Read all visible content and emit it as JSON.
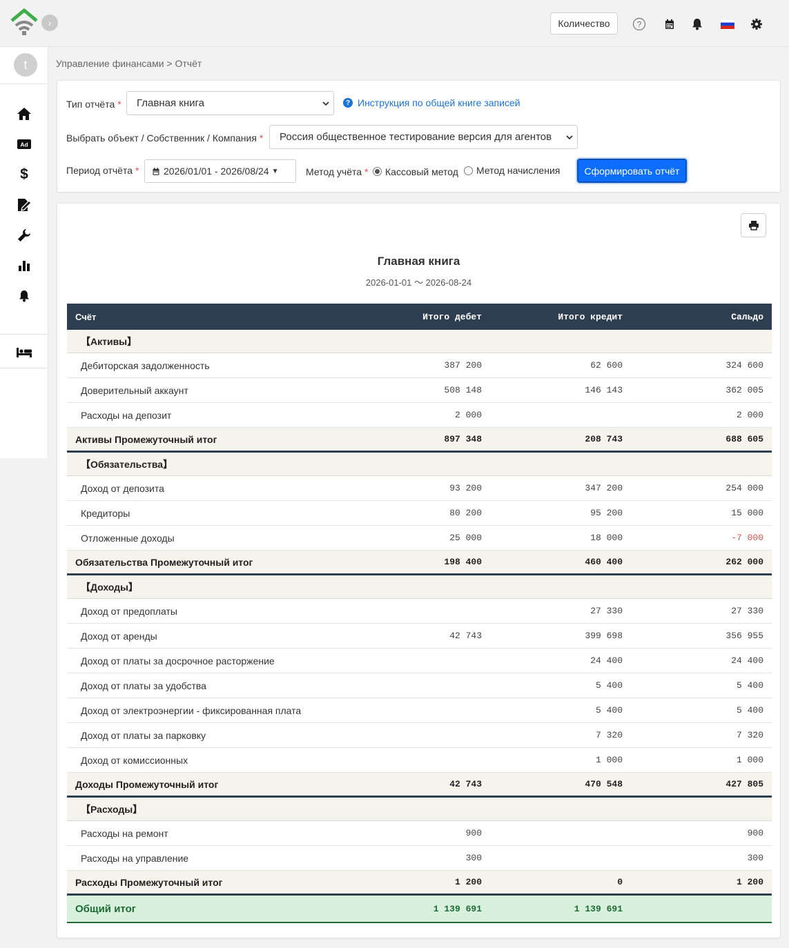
{
  "header": {
    "quantity_button": "Количество",
    "icons": [
      "help-icon",
      "calendar-icon",
      "bell-icon",
      "russia-flag-icon",
      "gear-icon"
    ]
  },
  "sidebar": {
    "avatar_initial": "t",
    "items": [
      "home-icon",
      "ad-icon",
      "dollar-icon",
      "contract-icon",
      "wrench-icon",
      "bar-chart-icon",
      "bell-icon",
      "bed-icon"
    ]
  },
  "breadcrumb": "Управление финансами > Отчёт",
  "filters": {
    "report_type_label": "Тип отчёта",
    "report_type_value": "Главная книга",
    "help_link": "Инструкция по общей книге записей",
    "object_label": "Выбрать объект / Собственник / Компания",
    "object_value": "Россия общественное тестирование версия для агентов",
    "period_label": "Период отчёта",
    "period_value": "2026/01/01 - 2026/08/24",
    "method_label": "Метод учёта",
    "method_cash": "Кассовый метод",
    "method_accrual": "Метод начисления",
    "method_selected": "cash",
    "generate_button": "Сформировать отчёт"
  },
  "report": {
    "title": "Главная книга",
    "period": "2026-01-01 〜 2026-08-24",
    "columns": {
      "account": "Счёт",
      "debit": "Итого дебет",
      "credit": "Итого кредит",
      "balance": "Сальдо"
    },
    "sections": [
      {
        "name": "【Активы】",
        "rows": [
          {
            "account": "Дебиторская задолженность",
            "debit": "387 200",
            "credit": "62 600",
            "balance": "324 600"
          },
          {
            "account": "Доверительный аккаунт",
            "debit": "508 148",
            "credit": "146 143",
            "balance": "362 005"
          },
          {
            "account": "Расходы на депозит",
            "debit": "2 000",
            "credit": "",
            "balance": "2 000"
          }
        ],
        "subtotal": {
          "label": "Активы Промежуточный итог",
          "debit": "897 348",
          "credit": "208 743",
          "balance": "688 605"
        }
      },
      {
        "name": "【Обязательства】",
        "rows": [
          {
            "account": "Доход от депозита",
            "debit": "93 200",
            "credit": "347 200",
            "balance": "254 000"
          },
          {
            "account": "Кредиторы",
            "debit": "80 200",
            "credit": "95 200",
            "balance": "15 000"
          },
          {
            "account": "Отложенные доходы",
            "debit": "25 000",
            "credit": "18 000",
            "balance": "-7 000"
          }
        ],
        "subtotal": {
          "label": "Обязательства Промежуточный итог",
          "debit": "198 400",
          "credit": "460 400",
          "balance": "262 000"
        }
      },
      {
        "name": "【Доходы】",
        "rows": [
          {
            "account": "Доход от предоплаты",
            "debit": "",
            "credit": "27 330",
            "balance": "27 330"
          },
          {
            "account": "Доход от аренды",
            "debit": "42 743",
            "credit": "399 698",
            "balance": "356 955"
          },
          {
            "account": "Доход от платы за досрочное расторжение",
            "debit": "",
            "credit": "24 400",
            "balance": "24 400"
          },
          {
            "account": "Доход от платы за удобства",
            "debit": "",
            "credit": "5 400",
            "balance": "5 400"
          },
          {
            "account": "Доход от электроэнергии - фиксированная плата",
            "debit": "",
            "credit": "5 400",
            "balance": "5 400"
          },
          {
            "account": "Доход от платы за парковку",
            "debit": "",
            "credit": "7 320",
            "balance": "7 320"
          },
          {
            "account": "Доход от комиссионных",
            "debit": "",
            "credit": "1 000",
            "balance": "1 000"
          }
        ],
        "subtotal": {
          "label": "Доходы Промежуточный итог",
          "debit": "42 743",
          "credit": "470 548",
          "balance": "427 805"
        }
      },
      {
        "name": "【Расходы】",
        "rows": [
          {
            "account": "Расходы на ремонт",
            "debit": "900",
            "credit": "",
            "balance": "900"
          },
          {
            "account": "Расходы на управление",
            "debit": "300",
            "credit": "",
            "balance": "300"
          }
        ],
        "subtotal": {
          "label": "Расходы Промежуточный итог",
          "debit": "1 200",
          "credit": "0",
          "balance": "1 200"
        }
      }
    ],
    "total": {
      "label": "Общий итог",
      "debit": "1 139 691",
      "credit": "1 139 691",
      "balance": ""
    }
  },
  "colors": {
    "accent": "#0d6efd",
    "header": "#2c3e50",
    "total_bg": "#d7f1dc",
    "negative": "#d9534f"
  }
}
